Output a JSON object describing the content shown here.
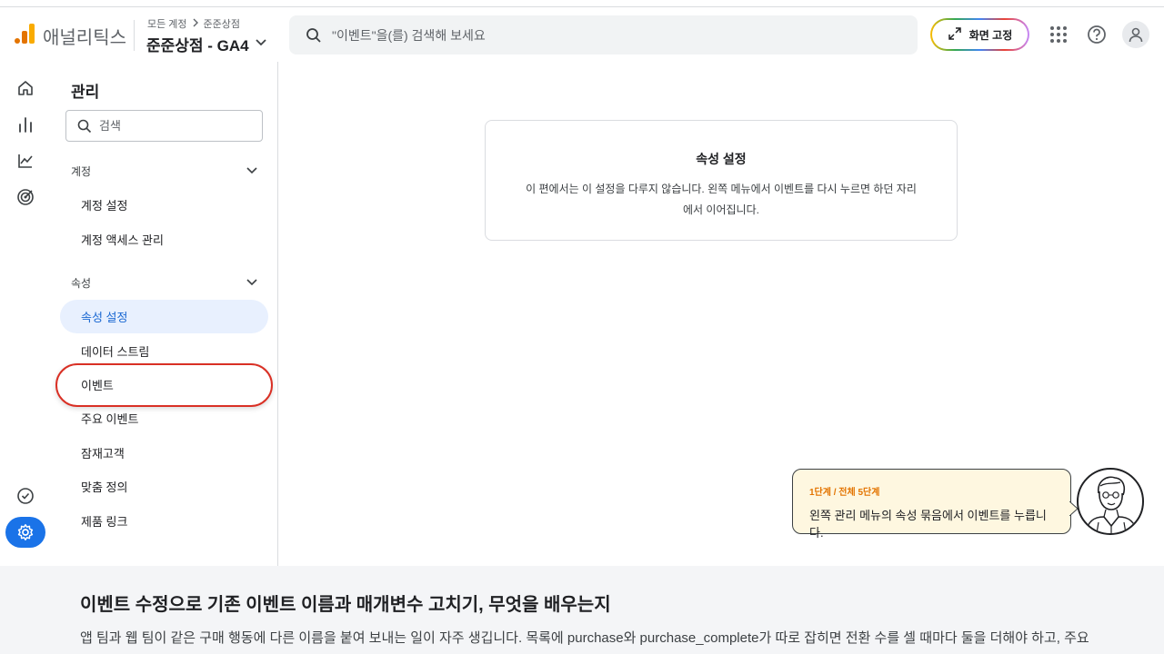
{
  "header": {
    "app_name": "애널리틱스",
    "breadcrumb": [
      "모든 계정",
      "준준상점"
    ],
    "property_title": "준준상점 - GA4",
    "search_placeholder": "\"이벤트\"을(를) 검색해 보세요",
    "pin_label": "화면 고정",
    "icons": [
      "apps-icon",
      "help-icon",
      "account-icon"
    ]
  },
  "rail": {
    "icons": [
      "home-icon",
      "reports-icon",
      "explore-icon",
      "advertising-icon",
      "insights-check-icon",
      "admin-gear-icon"
    ],
    "active": "admin-gear-icon"
  },
  "admin_nav": {
    "title": "관리",
    "search_placeholder": "검색",
    "account_section": {
      "label": "계정",
      "items": [
        "계정 설정",
        "계정 액세스 관리"
      ]
    },
    "property_section": {
      "label": "속성",
      "items": [
        "속성 설정",
        "데이터 스트림",
        "이벤트",
        "주요 이벤트",
        "잠재고객",
        "맞춤 정의",
        "제품 링크"
      ],
      "active_item": "속성 설정",
      "highlighted_item": "이벤트"
    }
  },
  "main": {
    "card_title": "속성 설정",
    "card_body": "이 편에서는 이 설정을 다루지 않습니다. 왼쪽 메뉴에서 이벤트를 다시 누르면 하던 자리에서 이어집니다."
  },
  "tutorial": {
    "step_label": "1단계 / 전체 5단계",
    "message": "왼쪽 관리 메뉴의 속성 묶음에서 이벤트를 누릅니다.",
    "step_color": "#e37400",
    "bubble_color": "#fef7e0"
  },
  "article": {
    "title": "이벤트 수정으로 기존 이벤트 이름과 매개변수 고치기, 무엇을 배우는지",
    "text": "앱 팀과 웹 팀이 같은 구매 행동에 다른 이름을 붙여 보내는 일이 자주 생깁니다. 목록에 purchase와 purchase_complete가 따로 잡히면 전환 수를 셀 때마다 둘을 더해야 하고, 주요 이벤트"
  },
  "colors": {
    "accent": "#1a73e8",
    "active_bg": "#e8f0fe",
    "highlight_ring": "#d93025"
  }
}
